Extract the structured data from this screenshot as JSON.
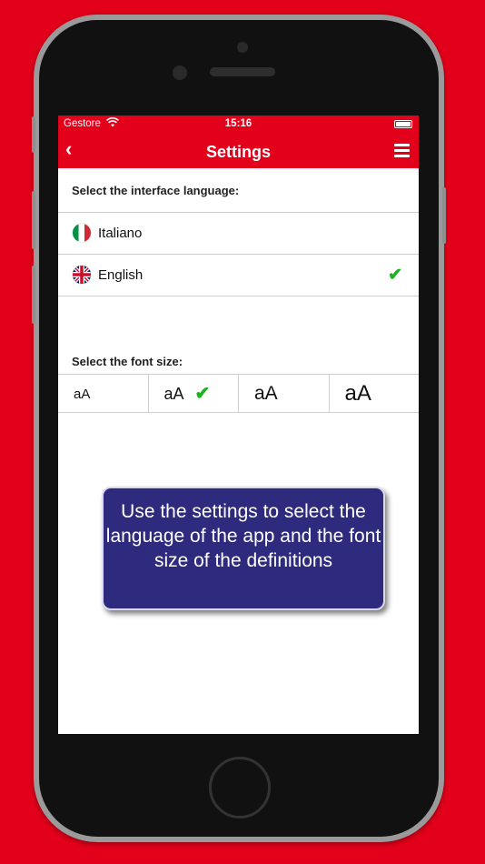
{
  "colors": {
    "brand": "#e2001a",
    "tooltip": "#2e2a7e",
    "check": "#1ab51a"
  },
  "status": {
    "carrier": "Gestore",
    "time": "15:16"
  },
  "navbar": {
    "back_icon": "chevron-left-icon",
    "title": "Settings",
    "menu_icon": "hamburger-menu-icon"
  },
  "language": {
    "header": "Select the interface language:",
    "options": [
      {
        "label": "Italiano",
        "flag": "italy-flag-icon",
        "selected": false
      },
      {
        "label": "English",
        "flag": "uk-flag-icon",
        "selected": true
      }
    ]
  },
  "font": {
    "header": "Select the font size:",
    "options": [
      {
        "label": "aA",
        "selected": false
      },
      {
        "label": "aA",
        "selected": true
      },
      {
        "label": "aA",
        "selected": false
      },
      {
        "label": "aA",
        "selected": false
      }
    ]
  },
  "tooltip": {
    "text": "Use the settings to select the language of the app and the font size of the definitions"
  }
}
